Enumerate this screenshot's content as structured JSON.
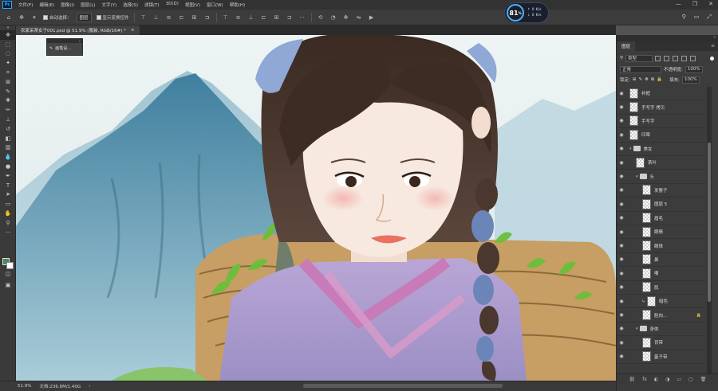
{
  "menubar": {
    "logo": "Ps",
    "items": [
      "文件(F)",
      "编辑(E)",
      "图像(I)",
      "图层(L)",
      "文字(Y)",
      "选择(S)",
      "滤镜(T)",
      "3D(D)",
      "视图(V)",
      "窗口(W)",
      "帮助(H)"
    ],
    "controls": [
      "—",
      "❐",
      "✕"
    ]
  },
  "options": {
    "auto_select_label": "自动选择：",
    "auto_select_value": "图层",
    "show_transform_label": "显示变换控件",
    "right_icons": [
      "⚲",
      "▭",
      "⤢"
    ]
  },
  "perf_widget": {
    "percent": "81",
    "percent_unit": "%",
    "up_rate": "0",
    "up_unit": "K/s",
    "down_rate": "0",
    "down_unit": "K/s"
  },
  "document_tab": {
    "title": "农家采茶女子001.psd @ 51.9% (服装, RGB/16#) *",
    "close": "×"
  },
  "floating_panel": {
    "label": "画笔设..."
  },
  "statusbar": {
    "zoom": "51.9%",
    "doc_info": "文档:236.8M/1.40G",
    "arrow": "›"
  },
  "layers_panel": {
    "tab_label": "图层",
    "filter_kind": "类型",
    "blend_mode": "正常",
    "opacity_label": "不透明度:",
    "opacity_value": "100%",
    "lock_label": "锁定:",
    "fill_label": "填充:",
    "fill_value": "100%",
    "layers": [
      {
        "name": "补框",
        "type": "layer",
        "indent": 0
      },
      {
        "name": "手写字 拷贝",
        "type": "layer",
        "indent": 0
      },
      {
        "name": "手写字",
        "type": "layer",
        "indent": 0
      },
      {
        "name": "印章",
        "type": "layer",
        "indent": 0
      },
      {
        "name": "美女",
        "type": "group",
        "indent": 0
      },
      {
        "name": "茶叶",
        "type": "layer",
        "indent": 1
      },
      {
        "name": "头",
        "type": "group",
        "indent": 1
      },
      {
        "name": "发簪子",
        "type": "layer",
        "indent": 2
      },
      {
        "name": "图层 5",
        "type": "layer",
        "indent": 2
      },
      {
        "name": "眉毛",
        "type": "layer",
        "indent": 2
      },
      {
        "name": "眼睛",
        "type": "layer",
        "indent": 2
      },
      {
        "name": "眼珠",
        "type": "layer",
        "indent": 2
      },
      {
        "name": "鼻",
        "type": "layer",
        "indent": 2
      },
      {
        "name": "嘴",
        "type": "layer",
        "indent": 2
      },
      {
        "name": "肌",
        "type": "layer",
        "indent": 2
      },
      {
        "name": "暗色",
        "type": "layer",
        "indent": 2,
        "clipped": true
      },
      {
        "name": "脸向...",
        "type": "layer",
        "indent": 2,
        "locked": true
      },
      {
        "name": "身体",
        "type": "group",
        "indent": 1
      },
      {
        "name": "背带",
        "type": "layer",
        "indent": 2
      },
      {
        "name": "篓子带",
        "type": "layer",
        "indent": 2
      }
    ],
    "footer_icons": [
      "fx",
      "◐",
      "◑",
      "▭",
      "▢",
      "⊕",
      "🗑"
    ]
  },
  "colors": {
    "foreground": "#4a8a5a",
    "background": "#ffffff",
    "accent": "#31a8ff"
  }
}
